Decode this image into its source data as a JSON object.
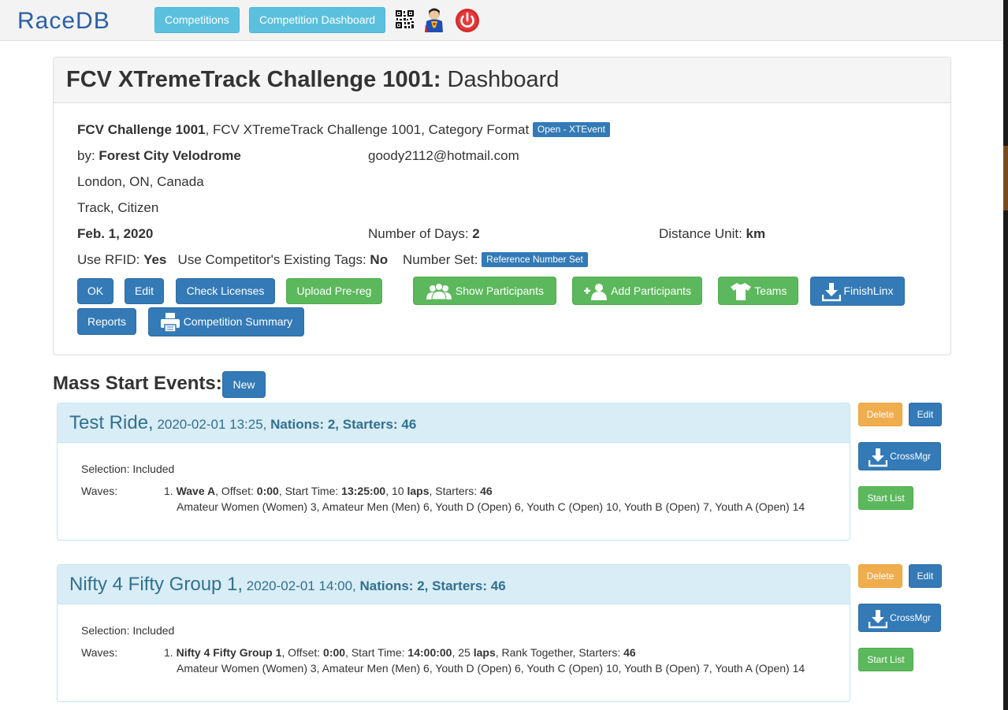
{
  "navbar": {
    "logo_text": "RaceDB",
    "competitions_label": "Competitions",
    "dashboard_label": "Competition Dashboard"
  },
  "dashboard": {
    "title_bold": "FCV XTremeTrack Challenge 1001:",
    "title_rest": " Dashboard",
    "competition_name": "FCV Challenge 1001",
    "competition_desc": ", FCV XTremeTrack Challenge 1001, Category Format ",
    "format_badge": "Open - XTEvent",
    "by_label": "by: ",
    "organizer": "Forest City Velodrome",
    "email": "goody2112@hotmail.com",
    "location": "London, ON, Canada",
    "discipline": "Track, Citizen",
    "date": "Feb. 1, 2020",
    "days_label": "Number of Days: ",
    "days_value": "2",
    "distance_label": "Distance Unit: ",
    "distance_value": "km",
    "rfid_label": "Use RFID: ",
    "rfid_value": "Yes",
    "tags_label": "Use Competitor's Existing Tags: ",
    "tags_value": "No",
    "numset_label": "Number Set: ",
    "numset_badge": "Reference Number Set",
    "buttons": {
      "ok": "OK",
      "edit": "Edit",
      "check_licenses": "Check Licenses",
      "upload_prereg": "Upload Pre-reg",
      "show_participants": "Show Participants",
      "add_participants": "Add Participants",
      "teams": "Teams",
      "finishlinx": "FinishLinx",
      "reports": "Reports",
      "competition_summary": "Competition Summary"
    }
  },
  "mass_start": {
    "title": "Mass Start Events:",
    "new_label": "New"
  },
  "events": [
    {
      "name": "Test Ride,",
      "datetime": " 2020-02-01 13:25,",
      "nations": " Nations: 2,",
      "starters": " Starters: 46",
      "selection_label": "Selection:",
      "selection_value": " Included",
      "waves_label": "Waves:",
      "wave_num": "1. ",
      "wave_name": "Wave A",
      "offset_label": ", Offset: ",
      "offset_value": "0:00",
      "start_label": ", Start Time: ",
      "start_value": "13:25:00",
      "laps_count": ", 10 ",
      "laps_word": "laps",
      "extra": ", Starters: ",
      "wave_starters": "46",
      "categories": "Amateur Women (Women) 3, Amateur Men (Men) 6, Youth D (Open) 6, Youth C (Open) 10, Youth B (Open) 7, Youth A (Open) 14",
      "delete_label": "Delete",
      "edit_label": "Edit",
      "crossmgr_label": "CrossMgr",
      "startlist_label": "Start List"
    },
    {
      "name": "Nifty 4 Fifty Group 1,",
      "datetime": " 2020-02-01 14:00,",
      "nations": " Nations: 2,",
      "starters": " Starters: 46",
      "selection_label": "Selection:",
      "selection_value": " Included",
      "waves_label": "Waves:",
      "wave_num": "1. ",
      "wave_name": "Nifty 4 Fifty Group 1",
      "offset_label": ", Offset: ",
      "offset_value": "0:00",
      "start_label": ", Start Time: ",
      "start_value": "14:00:00",
      "laps_count": ", 25 ",
      "laps_word": "laps",
      "extra": ", Rank Together, Starters: ",
      "wave_starters": "46",
      "categories": "Amateur Women (Women) 3, Amateur Men (Men) 6, Youth D (Open) 6, Youth C (Open) 10, Youth B (Open) 7, Youth A (Open) 14",
      "delete_label": "Delete",
      "edit_label": "Edit",
      "crossmgr_label": "CrossMgr",
      "startlist_label": "Start List"
    }
  ],
  "colors": {
    "primary": "#337ab7",
    "success": "#5cb85c",
    "info": "#5bc0de",
    "warning": "#f0ad4e",
    "event_header": "#d9edf7",
    "event_text": "#31708f"
  },
  "icons": [
    "qr-code-icon",
    "superhero-avatar-icon",
    "power-icon",
    "participants-icon",
    "add-participant-icon",
    "tshirt-icon",
    "download-icon",
    "printer-icon"
  ]
}
